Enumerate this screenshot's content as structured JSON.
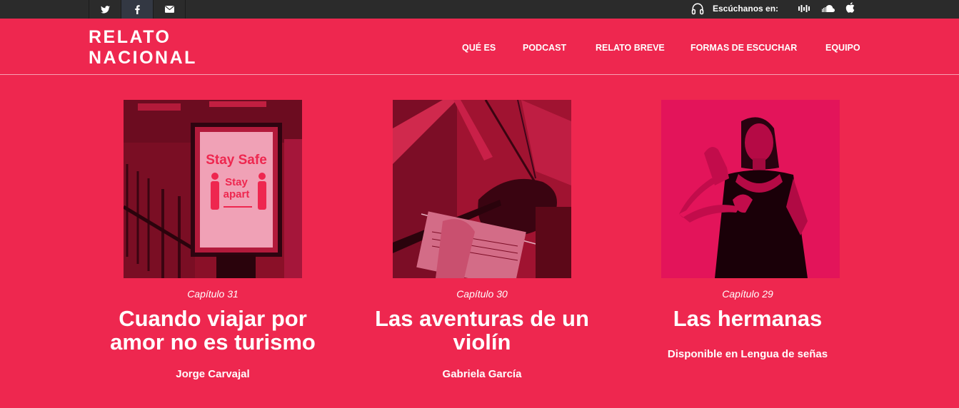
{
  "topbar": {
    "social": [
      {
        "icon": "twitter-icon"
      },
      {
        "icon": "facebook-icon"
      },
      {
        "icon": "mail-icon"
      }
    ],
    "listen_label": "Escúchanos en:",
    "services": [
      "spotify-icon",
      "soundcloud-icon",
      "apple-icon"
    ]
  },
  "header": {
    "logo_line1": "RELATO",
    "logo_line2": "NACIONAL",
    "nav": [
      "QUÉ ES",
      "PODCAST",
      "RELATO BREVE",
      "FORMAS DE ESCUCHAR",
      "EQUIPO"
    ]
  },
  "cards": [
    {
      "chapter": "Capítulo 31",
      "title_line1": "Cuando viajar por",
      "title_line2": "amor no es turismo",
      "author": "Jorge Carvajal",
      "sign_text1": "Stay Safe",
      "sign_text2": "Stay",
      "sign_text3": "apart"
    },
    {
      "chapter": "Capítulo 30",
      "title_line1": "Las aventuras de un",
      "title_line2": "violín",
      "author": "Gabriela García"
    },
    {
      "chapter": "Capítulo 29",
      "title_line1": "Las hermanas",
      "title_line2": "",
      "author": "Disponible en Lengua de señas"
    }
  ],
  "colors": {
    "brand": "#ee274f",
    "topbar": "#2b2b2b"
  }
}
